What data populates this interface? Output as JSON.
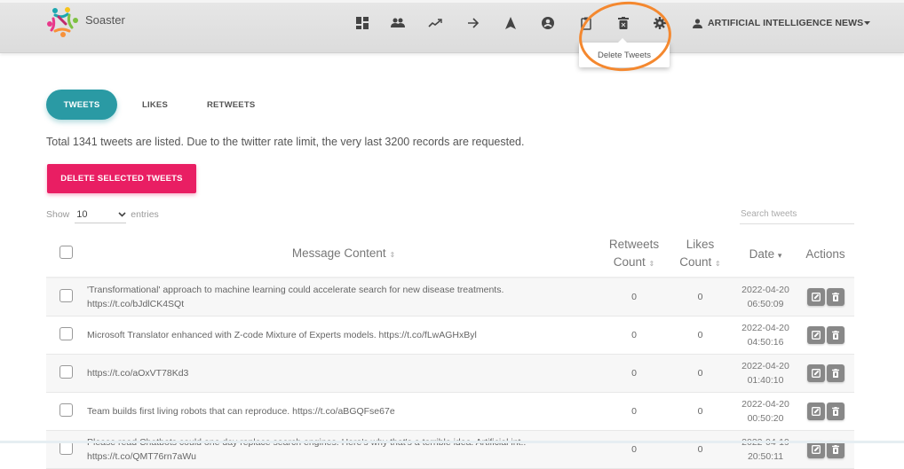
{
  "app": {
    "brand": "Soaster"
  },
  "nav": {
    "icons": [
      "dashboard-icon",
      "followers-icon",
      "trending-icon",
      "arrow-right-icon",
      "navigation-icon",
      "account-circle-icon",
      "clipboard-icon",
      "delete-icon",
      "settings-icon"
    ],
    "user_label": "ARTIFICIAL INTELLIGENCE NEWS",
    "tooltip": "Delete Tweets"
  },
  "tabs": [
    {
      "label": "TWEETS",
      "active": true
    },
    {
      "label": "LIKES",
      "active": false
    },
    {
      "label": "RETWEETS",
      "active": false
    }
  ],
  "info_text": "Total 1341 tweets are listed. Due to the twitter rate limit, the very last 3200 records are requested.",
  "delete_button": "DELETE SELECTED TWEETS",
  "length": {
    "show": "Show",
    "value": "10",
    "entries": "entries"
  },
  "search": {
    "placeholder": "Search tweets",
    "value": ""
  },
  "table": {
    "headers": {
      "message": "Message Content",
      "retweets_1": "Retweets",
      "retweets_2": "Count",
      "likes_1": "Likes",
      "likes_2": "Count",
      "date": "Date",
      "actions": "Actions"
    },
    "rows": [
      {
        "message": "'Transformational' approach to machine learning could accelerate search for new disease treatments.",
        "message2": "https://t.co/bJdlCK4SQt",
        "retweets": "0",
        "likes": "0",
        "date": "2022-04-20",
        "time": "06:50:09"
      },
      {
        "message": "Microsoft Translator enhanced with Z-code Mixture of Experts models. https://t.co/fLwAGHxByl",
        "message2": "",
        "retweets": "0",
        "likes": "0",
        "date": "2022-04-20",
        "time": "04:50:16"
      },
      {
        "message": "https://t.co/aOxVT78Kd3",
        "message2": "",
        "retweets": "0",
        "likes": "0",
        "date": "2022-04-20",
        "time": "01:40:10"
      },
      {
        "message": "Team builds first living robots that can reproduce. https://t.co/aBGQFse67e",
        "message2": "",
        "retweets": "0",
        "likes": "0",
        "date": "2022-04-20",
        "time": "00:50:20"
      },
      {
        "message": "Please read Chatbots could one day replace search engines. Here's why that's a terrible idea. Artificial int..",
        "message2": "https://t.co/QMT76rn7aWu",
        "retweets": "0",
        "likes": "0",
        "date": "2022-04-19",
        "time": "20:50:11"
      }
    ]
  },
  "colors": {
    "accent": "#2a9aa4",
    "danger": "#e91e63",
    "highlight": "#f4882f"
  }
}
